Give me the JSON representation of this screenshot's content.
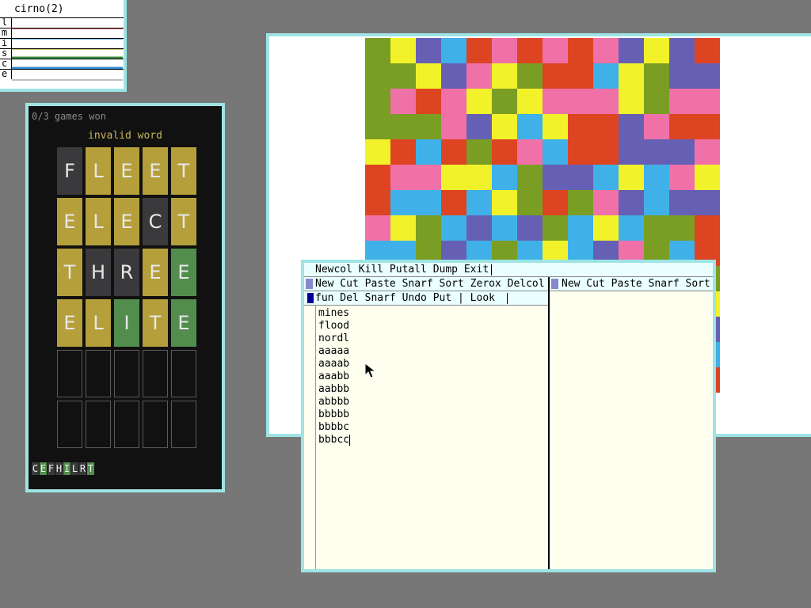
{
  "stats": {
    "title": "cirno(2)",
    "rows": [
      {
        "label": "l",
        "color": "#d03030"
      },
      {
        "label": "m",
        "color": "#3aa0d0"
      },
      {
        "label": "i",
        "color": "#c8b040"
      },
      {
        "label": "s",
        "color": "#3a8a3a"
      },
      {
        "label": "c",
        "color": "#2a8ad0"
      },
      {
        "label": "e",
        "color": "#aaaaaa"
      }
    ]
  },
  "wordle": {
    "games_won": "0/3 games won",
    "message": "invalid word",
    "rows": [
      {
        "letters": [
          "F",
          "L",
          "E",
          "E",
          "T"
        ],
        "states": [
          "x",
          "y",
          "y",
          "y",
          "y"
        ]
      },
      {
        "letters": [
          "E",
          "L",
          "E",
          "C",
          "T"
        ],
        "states": [
          "y",
          "y",
          "y",
          "x",
          "y"
        ]
      },
      {
        "letters": [
          "T",
          "H",
          "R",
          "E",
          "E"
        ],
        "states": [
          "y",
          "x",
          "x",
          "y",
          "g"
        ]
      },
      {
        "letters": [
          "E",
          "L",
          "I",
          "T",
          "E"
        ],
        "states": [
          "y",
          "y",
          "g",
          "y",
          "g"
        ]
      },
      {
        "letters": [
          "",
          "",
          "",
          "",
          ""
        ],
        "states": [
          "e",
          "e",
          "e",
          "e",
          "e"
        ]
      },
      {
        "letters": [
          "",
          "",
          "",
          "",
          ""
        ],
        "states": [
          "e",
          "e",
          "e",
          "e",
          "e"
        ]
      }
    ],
    "used_letters": [
      {
        "letter": "C",
        "color": "#3a3a3c"
      },
      {
        "letter": "E",
        "color": "#538d4e"
      },
      {
        "letter": "F",
        "color": "#3a3a3c"
      },
      {
        "letter": "H",
        "color": "#3a3a3c"
      },
      {
        "letter": "I",
        "color": "#538d4e"
      },
      {
        "letter": "L",
        "color": "#3a3a3c"
      },
      {
        "letter": "R",
        "color": "#3a3a3c"
      },
      {
        "letter": "T",
        "color": "#538d4e"
      }
    ]
  },
  "colors_game": {
    "palette": {
      "G": "#7a9e24",
      "Y": "#f2f22a",
      "P": "#6660b4",
      "B": "#40b0e8",
      "R": "#dd4422",
      "K": "#f070a8"
    },
    "rows": [
      "GYPBRKRKRKPYPR",
      "GGYPKYGRRBYGP",
      "GKRKYGYKKKYGKK",
      "GGGKPYBYRRPKRR",
      "YRBRGRKBRRPPPK",
      "RKKYYBGPPBYBKY",
      "RBBRBYGRGKPBP",
      "KYGBPBPGBYBGGR",
      "BBGPBGBYBPKGBR"
    ]
  },
  "acme": {
    "top_tag": "Newcol Kill Putall Dump Exit",
    "col1_tag": "New Cut Paste Snarf Sort Zerox Delcol",
    "col2_tag": "New Cut Paste Snarf Sort",
    "win_tag": "fun Del Snarf Undo Put | Look",
    "lines": [
      "mines",
      "flood",
      "nordl",
      "aaaaa",
      "aaaab",
      "aaabb",
      "aabbb",
      "abbbb",
      "bbbbb",
      "bbbbc",
      "bbbcc"
    ]
  }
}
